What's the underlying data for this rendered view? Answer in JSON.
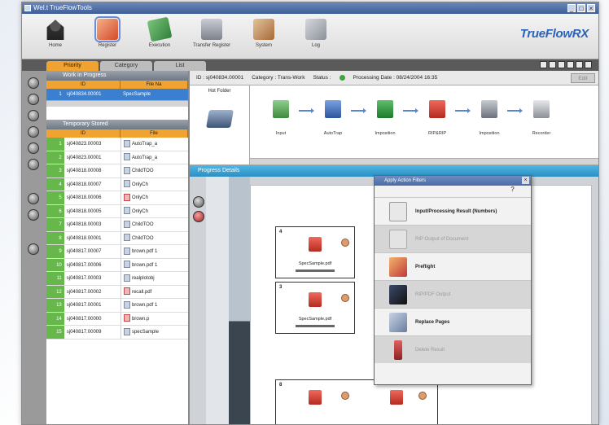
{
  "titlebar": {
    "title": "Wel.t TrueFlowTools",
    "controls": [
      "_",
      "□",
      "×"
    ]
  },
  "toolbar": {
    "buttons": [
      {
        "label": "Home",
        "icon": "home-icon"
      },
      {
        "label": "Register",
        "icon": "register-icon"
      },
      {
        "label": "Execution",
        "icon": "execution-icon"
      },
      {
        "label": "Transfer Register",
        "icon": "transfer-icon"
      },
      {
        "label": "System",
        "icon": "system-icon"
      },
      {
        "label": "Log",
        "icon": "log-icon"
      }
    ],
    "brand": "TrueFlowRX"
  },
  "tabs": [
    {
      "label": "Priority",
      "active": true
    },
    {
      "label": "Category",
      "active": false
    },
    {
      "label": "List",
      "active": false
    }
  ],
  "wip": {
    "title": "Work in Progress",
    "col_id": "ID",
    "col_file": "File Na",
    "rows": [
      {
        "num": "1",
        "id": "sj040834.00001",
        "file": "SpecSample"
      }
    ]
  },
  "temp": {
    "title": "Temporary Stored",
    "col_id": "ID",
    "col_file": "File",
    "rows": [
      {
        "num": "1",
        "id": "sj040823.00003",
        "file": "AutoTrap_a"
      },
      {
        "num": "2",
        "id": "sj040823.00001",
        "file": "AutoTrap_a"
      },
      {
        "num": "3",
        "id": "sj040818.00008",
        "file": "ChildTOO"
      },
      {
        "num": "4",
        "id": "sj040818.00007",
        "file": "OnlyCh"
      },
      {
        "num": "5",
        "id": "sj040818.00006",
        "file": "OnlyCh"
      },
      {
        "num": "6",
        "id": "sj040818.00005",
        "file": "OnlyCh"
      },
      {
        "num": "7",
        "id": "sj040818.00003",
        "file": "ChildTOO"
      },
      {
        "num": "8",
        "id": "sj040818.00001",
        "file": "ChildTOO"
      },
      {
        "num": "9",
        "id": "sj040817.00007",
        "file": "brown.pdf 1"
      },
      {
        "num": "10",
        "id": "sj040817.00006",
        "file": "brown.pdf 1"
      },
      {
        "num": "11",
        "id": "sj040817.00003",
        "file": "realplotobj"
      },
      {
        "num": "12",
        "id": "sj040817.00002",
        "file": "recall.pdf"
      },
      {
        "num": "13",
        "id": "sj040817.00001",
        "file": "brown.pdf 1"
      },
      {
        "num": "14",
        "id": "sj040817.00000",
        "file": "brown.p"
      },
      {
        "num": "15",
        "id": "sj040817.00009",
        "file": "specSample"
      }
    ]
  },
  "info": {
    "id_label": "ID : sj040834.00001",
    "category": "Category : Trans-Work",
    "status": "Status :",
    "processing": "Processing  Date : 08/24/2004 16:35",
    "edit": "Edit"
  },
  "hotfolder": {
    "label": "Hot Folder"
  },
  "flow": {
    "steps": [
      {
        "label": "Input"
      },
      {
        "label": "AutoTrap"
      },
      {
        "label": "Imposition"
      },
      {
        "label": "RIP&RIP"
      },
      {
        "label": "Imposition"
      },
      {
        "label": "Recorder"
      }
    ]
  },
  "progress": {
    "title": "Progress Details"
  },
  "cards": [
    {
      "num": "4",
      "label": "SpecSample.pdf"
    },
    {
      "num": "3",
      "label": "SpecSample.pdf"
    },
    {
      "num": "8",
      "label": ""
    }
  ],
  "popup": {
    "title": "Apply Action Filters",
    "help": "?",
    "items": [
      {
        "label": "Input/Processing Result (Numbers)",
        "dim": false
      },
      {
        "label": "RIP Output of Document",
        "dim": true
      },
      {
        "label": "Preflight",
        "dim": false
      },
      {
        "label": "RIP/PDF Output",
        "dim": true
      },
      {
        "label": "Replace Pages",
        "dim": false
      },
      {
        "label": "Delete Result",
        "dim": true
      }
    ]
  },
  "colors": {
    "accent": "#f0a330",
    "selection": "#3b7fd0",
    "rownum": "#66b84a",
    "progress_header": "#2a8fc3"
  }
}
